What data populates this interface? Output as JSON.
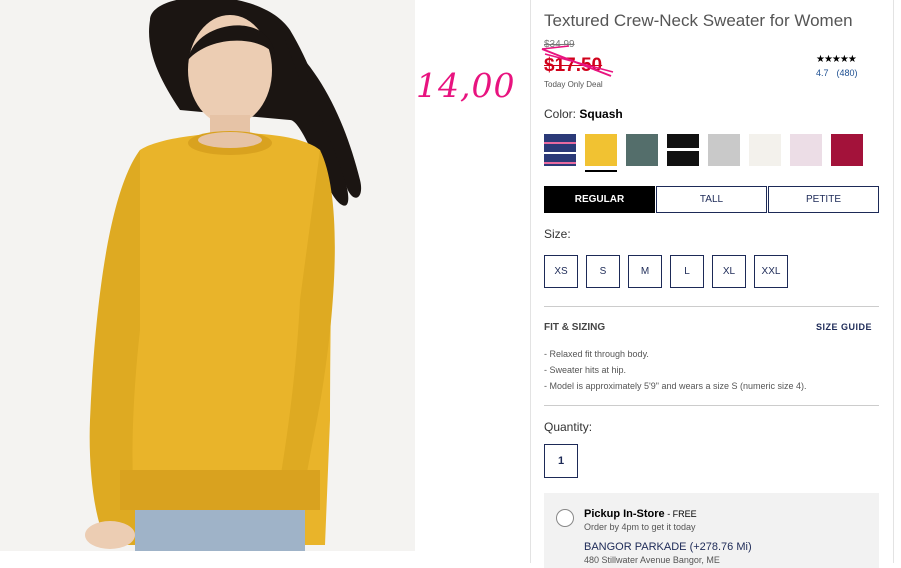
{
  "product": {
    "title": "Textured Crew-Neck Sweater for Women",
    "original_price": "$34.99",
    "sale_price": "$17.50",
    "deal_note": "Today Only Deal",
    "stars": "★★★★★",
    "rating": "4.7",
    "review_count": "(480)"
  },
  "annotation": {
    "text": "14,00",
    "color": "#e8137f"
  },
  "color": {
    "label": "Color:",
    "selected": "Squash",
    "swatches": [
      {
        "name": "navy-stripe",
        "hex": "#2b3a78"
      },
      {
        "name": "squash",
        "hex": "#f1c232"
      },
      {
        "name": "slate-green",
        "hex": "#546e6b"
      },
      {
        "name": "black-stripe",
        "hex": "#111111"
      },
      {
        "name": "heather-gray",
        "hex": "#c9c9c9"
      },
      {
        "name": "cream",
        "hex": "#f3f1ec"
      },
      {
        "name": "light-pink",
        "hex": "#ecdde6"
      },
      {
        "name": "burgundy",
        "hex": "#a3123a"
      }
    ]
  },
  "fit_options": [
    "REGULAR",
    "TALL",
    "PETITE"
  ],
  "size": {
    "label": "Size:",
    "options": [
      "XS",
      "S",
      "M",
      "L",
      "XL",
      "XXL"
    ]
  },
  "fit_sizing": {
    "title": "FIT & SIZING",
    "guide_link": "SIZE GUIDE",
    "bullets": [
      "Relaxed fit through body.",
      "Sweater hits at hip.",
      "Model is approximately 5'9\" and wears a size S (numeric size 4)."
    ]
  },
  "quantity": {
    "label": "Quantity:",
    "value": "1"
  },
  "pickup": {
    "title": "Pickup In-Store",
    "fee": " - FREE",
    "subtitle": "Order by 4pm to get it today",
    "store": "BANGOR PARKADE",
    "distance": "(+278.76 Mi)",
    "address": "480 Stillwater Avenue Bangor, ME"
  }
}
